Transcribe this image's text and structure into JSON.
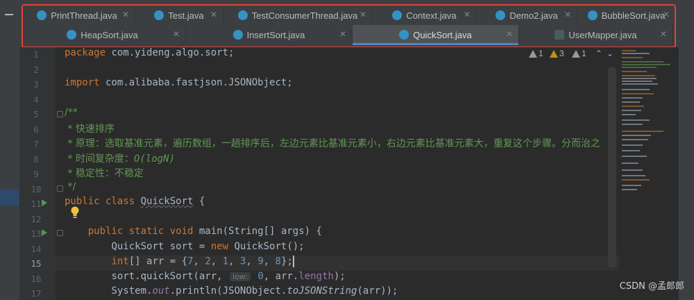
{
  "tabs_row1": [
    {
      "label": "PrintThread.java",
      "icon": "java-class-icon"
    },
    {
      "label": "Test.java",
      "icon": "java-class-icon"
    },
    {
      "label": "TestConsumerThread.java",
      "icon": "java-class-icon"
    },
    {
      "label": "Context.java",
      "icon": "java-class-icon"
    },
    {
      "label": "Demo2.java",
      "icon": "java-class-icon"
    },
    {
      "label": "BubbleSort.java",
      "icon": "java-class-icon"
    }
  ],
  "tabs_row2": [
    {
      "label": "HeapSort.java",
      "icon": "java-class-icon"
    },
    {
      "label": "InsertSort.java",
      "icon": "java-class-icon"
    },
    {
      "label": "QuickSort.java",
      "icon": "java-class-icon",
      "active": true
    },
    {
      "label": "UserMapper.java",
      "icon": "mapper-interface-icon"
    }
  ],
  "close_glyph": "✕",
  "inspections": {
    "weak_warnings": "1",
    "warnings": "3",
    "typos": "1",
    "up_arrow": "⌃",
    "down_arrow": "⌄"
  },
  "line_numbers": [
    "1",
    "2",
    "3",
    "4",
    "5",
    "6",
    "7",
    "8",
    "9",
    "10",
    "11",
    "12",
    "13",
    "14",
    "15",
    "16",
    "17"
  ],
  "current_line": "15",
  "code": {
    "package_kw": "package",
    "package_name": " com.yideng.algo.sort;",
    "import_kw": "import",
    "import_name": " com.alibaba.fastjson.JSONObject;",
    "doc_open": "/**",
    "doc_1": " * 快速排序",
    "doc_2": " * 原理：选取基准元素，遍历数组，一趟排序后，左边元素比基准元素小，右边元素比基准元素大，重复这个步骤。分而治之",
    "doc_3a": " * 时间复杂度：",
    "doc_3b": "O(logN)",
    "doc_4": " * 稳定性：不稳定",
    "doc_close": " */",
    "class_kw": "public class",
    "class_name": "QuickSort",
    "class_brace": " {",
    "main_kw": "public static void",
    "main_sig": " main(String[] args) {",
    "l14_type": "QuickSort sort = ",
    "l14_new": "new",
    "l14_rest": " QuickSort();",
    "l15_kw": "int",
    "l15_a": "[] arr = {",
    "l15_nums": [
      "7",
      "2",
      "1",
      "3",
      "9",
      "8"
    ],
    "l15_end": "};",
    "l16_a": "sort.quickSort(arr, ",
    "l16_hint": "low:",
    "l16_zero": "0",
    "l16_b": ", arr.",
    "l16_len": "length",
    "l16_end": ");",
    "l17_a": "System.",
    "l17_out": "out",
    "l17_b": ".println(JSONObject.",
    "l17_fn": "toJSONString",
    "l17_end": "(arr));"
  },
  "watermark": "CSDN @孟郎郎"
}
